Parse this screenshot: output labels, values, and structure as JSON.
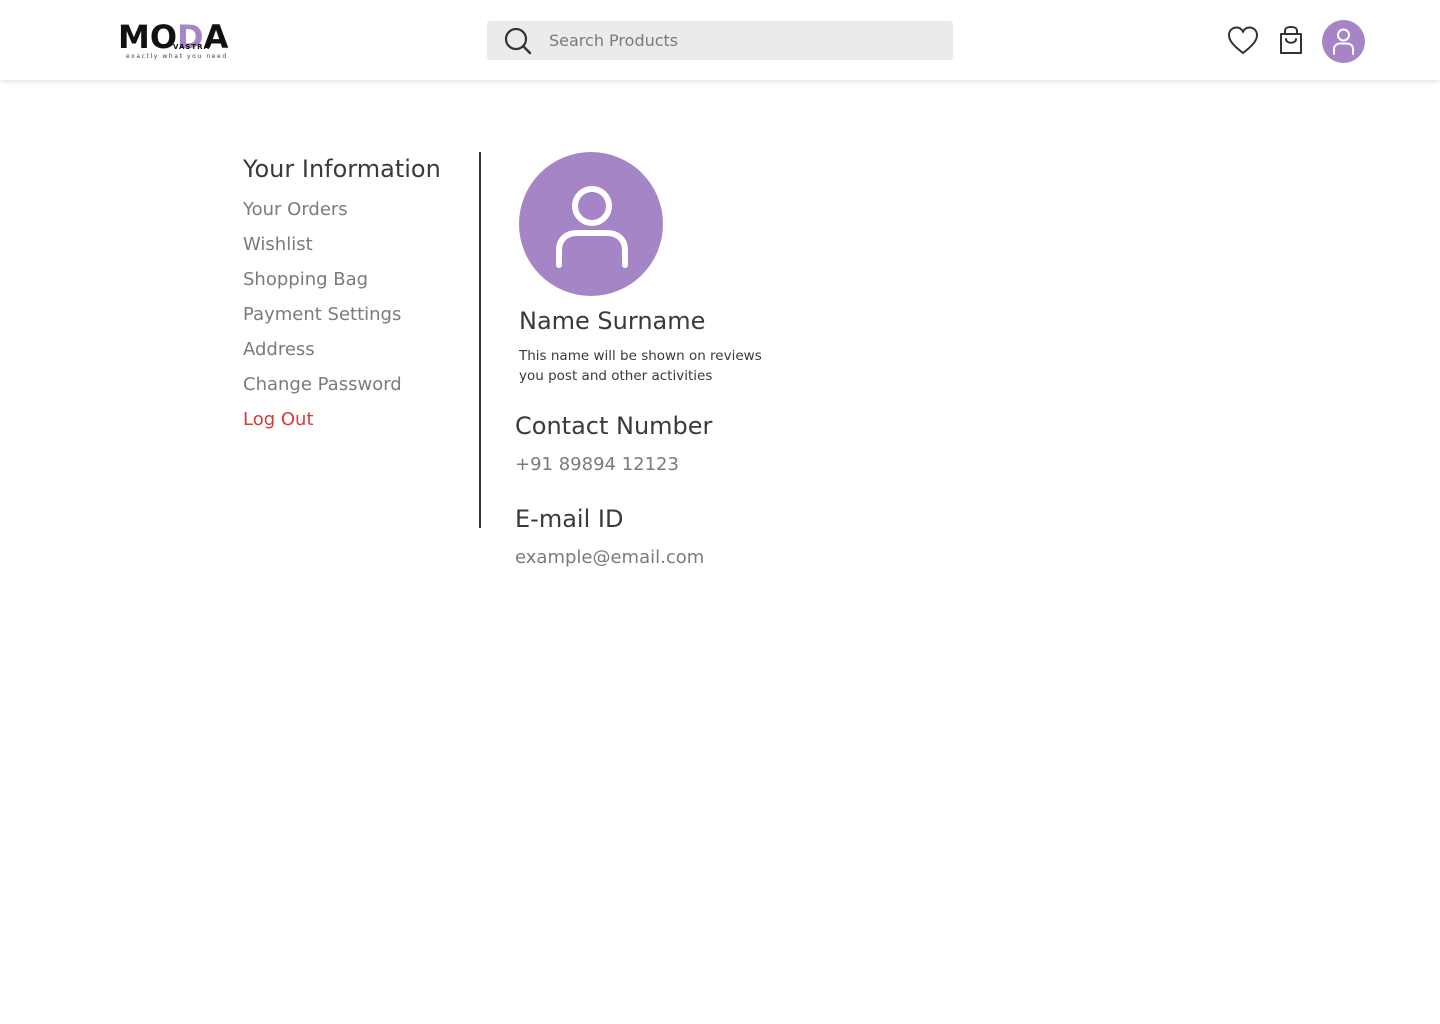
{
  "header": {
    "logo": {
      "wordmark": "MODA",
      "sub": "VASTRA",
      "tagline": "exactly what you need"
    },
    "search": {
      "placeholder": "Search Products",
      "value": ""
    },
    "icons": [
      "heart-icon",
      "shopping-bag-icon",
      "user-icon"
    ]
  },
  "sidebar": {
    "title": "Your Information",
    "items": [
      {
        "label": "Your Orders"
      },
      {
        "label": "Wishlist"
      },
      {
        "label": "Shopping Bag"
      },
      {
        "label": "Payment Settings"
      },
      {
        "label": "Address"
      },
      {
        "label": "Change Password"
      },
      {
        "label": "Log Out"
      }
    ]
  },
  "profile": {
    "name": "Name Surname",
    "note": "This name will be shown on reviews you post and other activities",
    "contact_label": "Contact Number",
    "contact_value": "+91 89894 12123",
    "email_label": "E-mail ID",
    "email_value": "example@email.com"
  },
  "colors": {
    "accent": "#a585c5",
    "danger": "#d63a3a",
    "muted": "#7b7b7b",
    "text": "#3a3a3a",
    "search_bg": "#ebebeb"
  }
}
